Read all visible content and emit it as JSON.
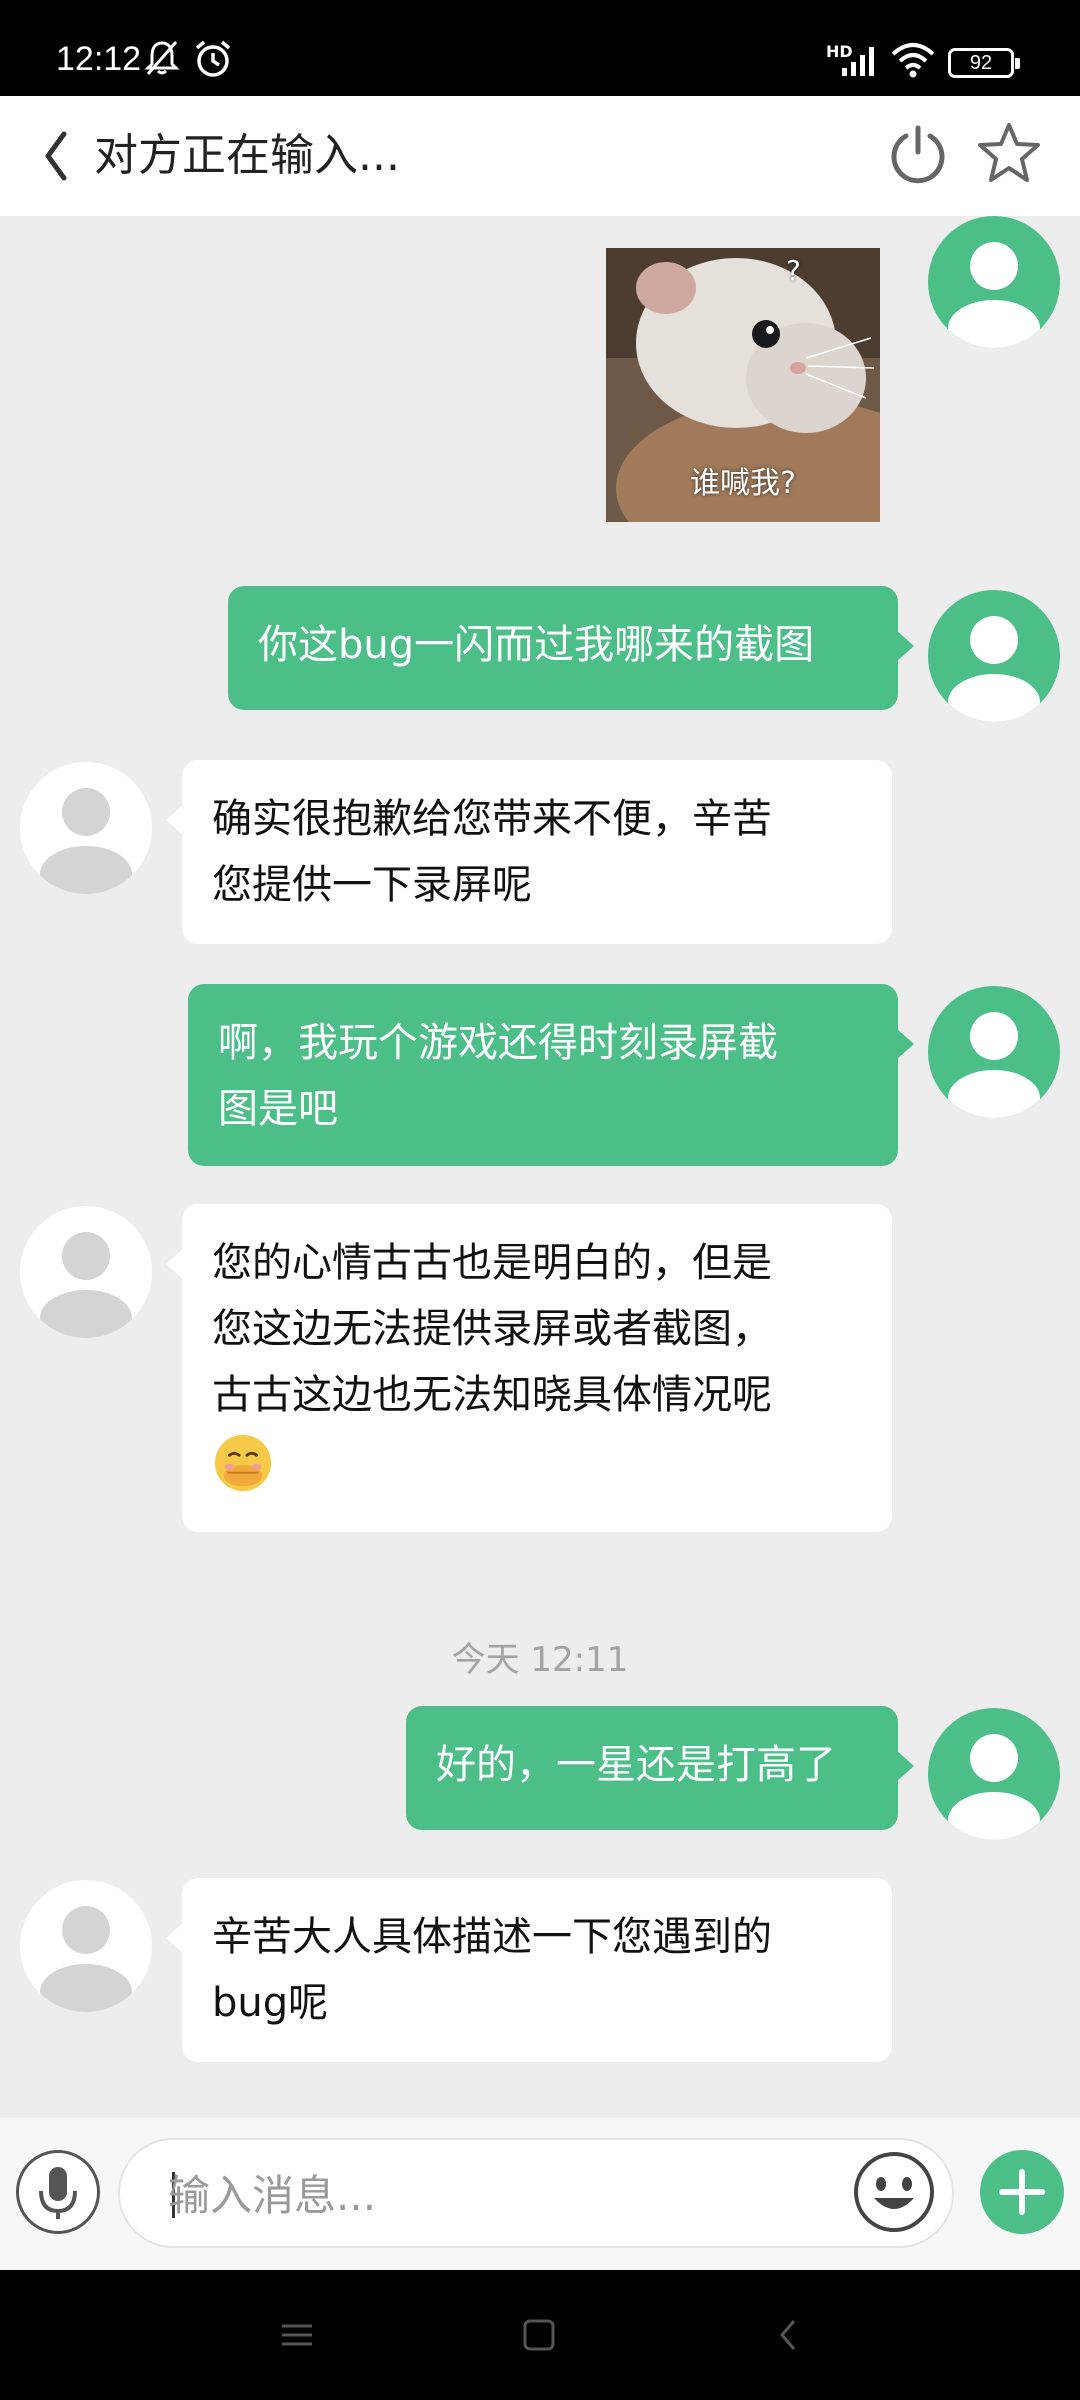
{
  "status_bar": {
    "time": "12:12",
    "network": "HD",
    "battery": "92"
  },
  "header": {
    "title": "对方正在输入..."
  },
  "messages": [
    {
      "sender": "me",
      "type": "sticker",
      "caption": "谁喊我?",
      "mark": "?"
    },
    {
      "sender": "me",
      "type": "text",
      "text": "你这bug一闪而过我哪来的截图"
    },
    {
      "sender": "other",
      "type": "text",
      "lines": [
        "确实很抱歉给您带来不便，辛苦",
        "您提供一下录屏呢"
      ]
    },
    {
      "sender": "me",
      "type": "text",
      "lines": [
        "啊，我玩个游戏还得时刻录屏截",
        "图是吧"
      ]
    },
    {
      "sender": "other",
      "type": "text",
      "lines": [
        "您的心情古古也是明白的，但是",
        "您这边无法提供录屏或者截图，",
        "古古这边也无法知晓具体情况呢"
      ],
      "emoji": "hand-over-mouth-emoji"
    },
    {
      "sender": "me",
      "type": "text",
      "text": "好的，一星还是打高了"
    },
    {
      "sender": "other",
      "type": "text",
      "lines": [
        "辛苦大人具体描述一下您遇到的",
        "bug呢"
      ]
    }
  ],
  "timestamp": "今天 12:11",
  "input": {
    "placeholder": "输入消息..."
  },
  "colors": {
    "accent": "#4cbf89",
    "background": "#ededed",
    "timestamp": "#a3a3a3"
  },
  "icons": [
    "back-chevron-icon",
    "power-icon",
    "star-icon",
    "mic-icon",
    "emoji-icon",
    "plus-icon",
    "menu-icon",
    "home-icon",
    "back-icon"
  ]
}
